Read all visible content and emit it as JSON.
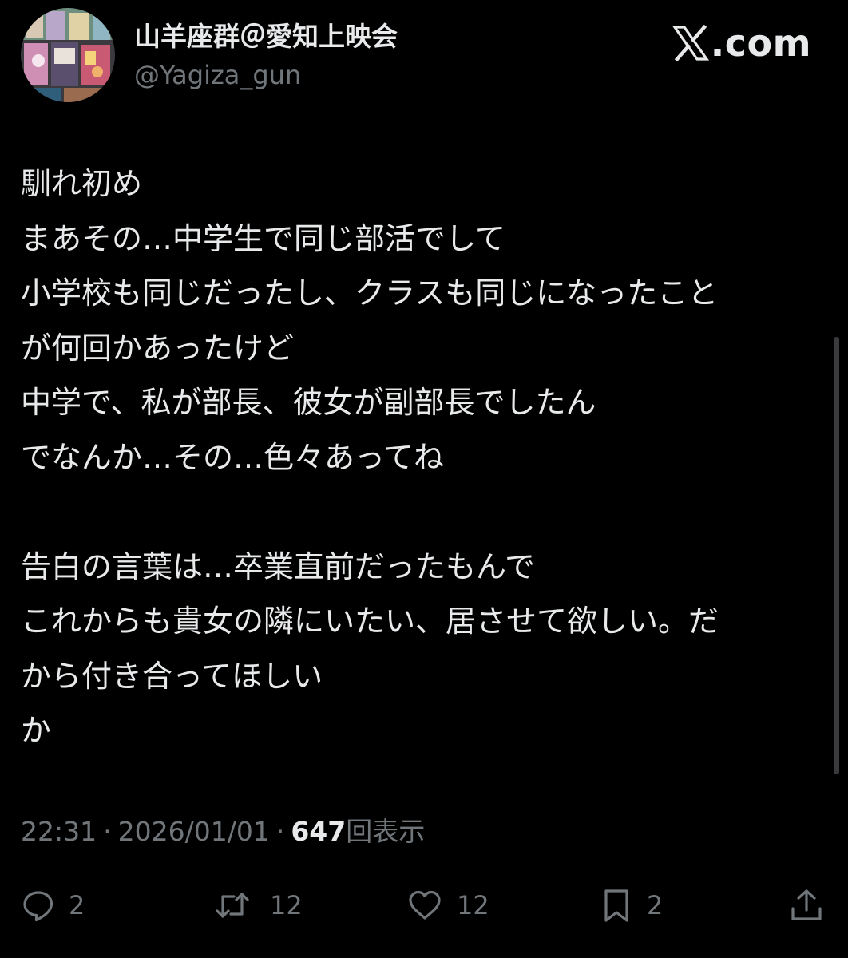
{
  "author": {
    "display_name": "山羊座群＠愛知上映会",
    "handle": "@Yagiza_gun",
    "avatar": "avatar-photo"
  },
  "brand": {
    "icon": "x-logo-icon",
    "text": ".com"
  },
  "tweet": {
    "lines": [
      "馴れ初め",
      "まあその…中学生で同じ部活でして",
      "小学校も同じだったし、クラスも同じになったこと",
      "が何回かあったけど",
      "中学で、私が部長、彼女が副部長でしたん",
      "でなんか…その…色々あってね",
      "",
      "告白の言葉は…卒業直前だったもんで",
      "これからも貴女の隣にいたい、居させて欲しい。だ",
      "から付き合ってほしい",
      "か"
    ]
  },
  "meta": {
    "time": "22:31",
    "date": "2026/01/01",
    "separator": "·",
    "views": "647",
    "views_label": "回表示"
  },
  "actions": {
    "reply": {
      "icon": "reply-icon",
      "count": "2"
    },
    "repost": {
      "icon": "repost-icon",
      "count": "12"
    },
    "like": {
      "icon": "heart-icon",
      "count": "12"
    },
    "bookmark": {
      "icon": "bookmark-icon",
      "count": "2"
    },
    "share": {
      "icon": "share-icon"
    }
  },
  "colors": {
    "background": "#000000",
    "primary_text": "#e7e9ea",
    "secondary_text": "#71767b"
  }
}
